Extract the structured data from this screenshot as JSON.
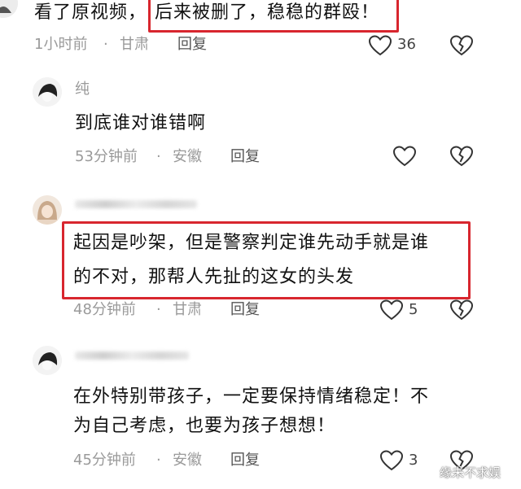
{
  "comments": [
    {
      "text_plain": "看了原视频，",
      "text_boxed": "后来被删了，稳稳的群殴！",
      "time": "1小时前",
      "location": "甘肃",
      "reply_label": "回复",
      "like_count": "36",
      "dislike_icon": "broken-heart-icon",
      "like_icon": "heart-icon"
    },
    {
      "nickname": "纯",
      "lines": [
        "到底谁对谁错啊"
      ],
      "time": "53分钟前",
      "location": "安徽",
      "reply_label": "回复",
      "like_count": "",
      "avatar_icon": "avatar-icon"
    },
    {
      "nickname": "",
      "lines": [
        "起因是吵架，但是警察判定谁先动手就是谁",
        "的不对，那帮人先扯的这女的头发"
      ],
      "time": "48分钟前",
      "location": "甘肃",
      "reply_label": "回复",
      "like_count": "5",
      "avatar_icon": "avatar-icon"
    },
    {
      "nickname": "",
      "lines": [
        "在外特别带孩子，一定要保持情绪稳定！不",
        "为自己考虑，也要为孩子想想！"
      ],
      "time": "45分钟前",
      "location": "安徽",
      "reply_label": "回复",
      "like_count": "3",
      "avatar_icon": "avatar-icon"
    }
  ],
  "separator": "·",
  "watermark": "缘未不求娱",
  "colors": {
    "highlight_border": "#d8262e",
    "meta_gray": "#9a9a9a"
  }
}
